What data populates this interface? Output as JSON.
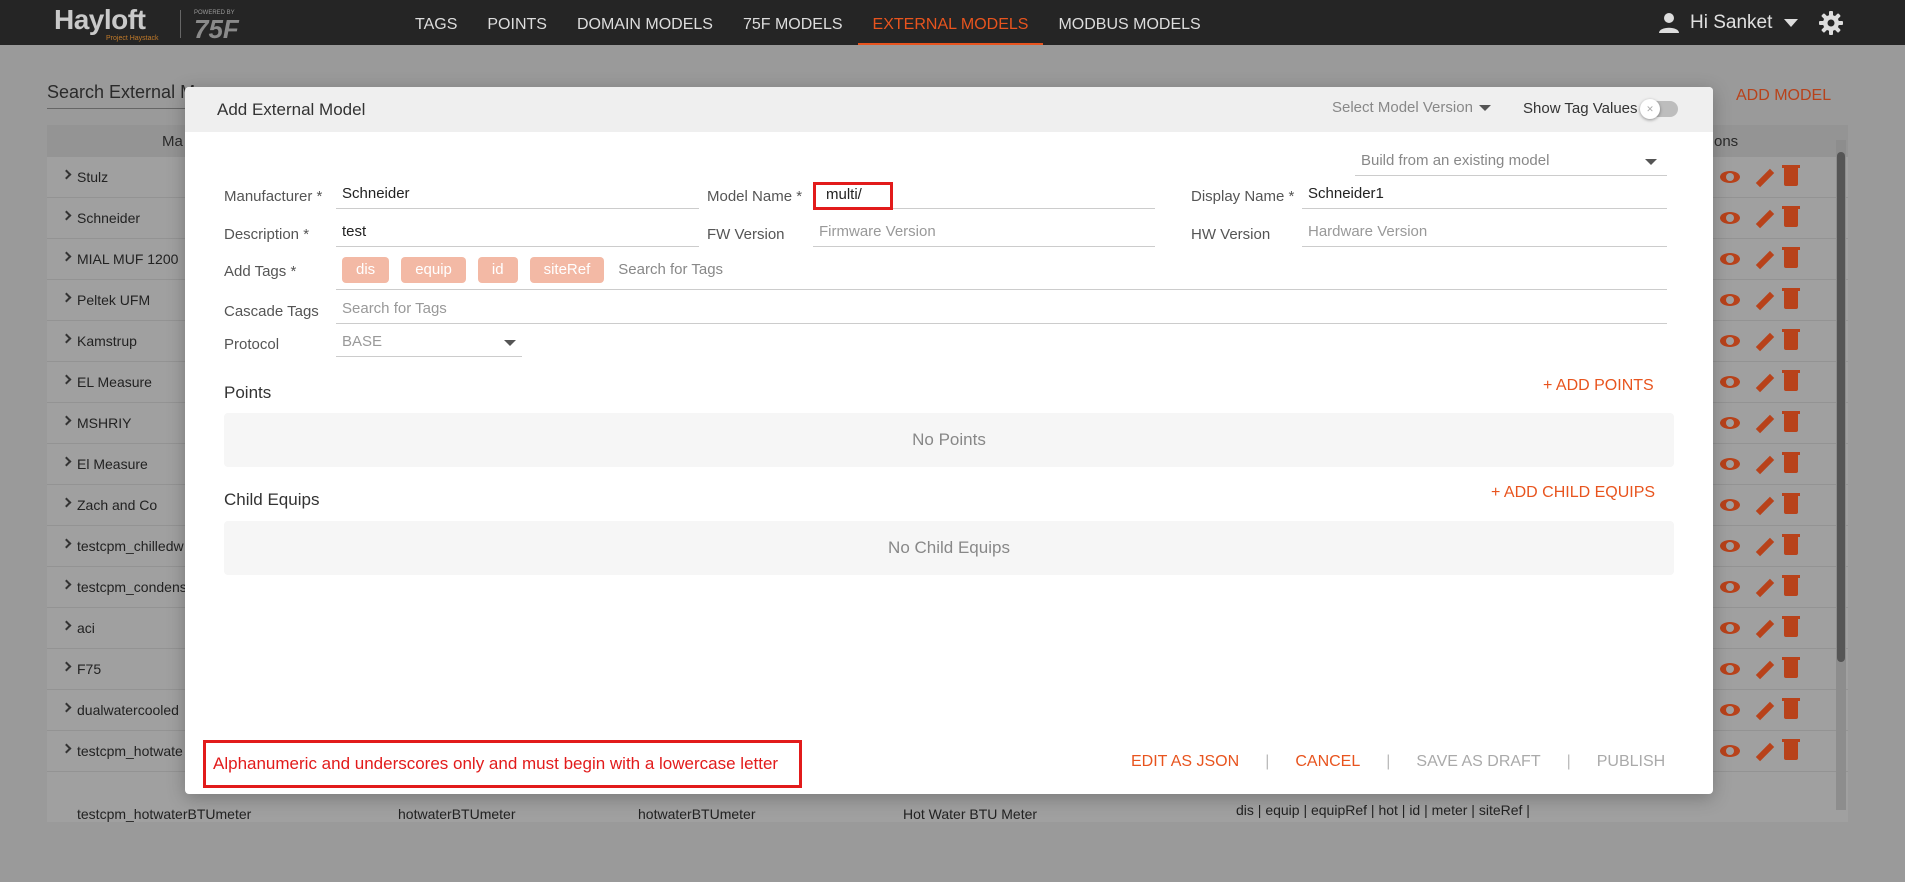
{
  "brand": {
    "name": "Hayloft",
    "tagline": "Project Haystack",
    "powered": "POWERED BY",
    "partner": "75F"
  },
  "nav": [
    {
      "label": "TAGS",
      "active": false
    },
    {
      "label": "POINTS",
      "active": false
    },
    {
      "label": "DOMAIN MODELS",
      "active": false
    },
    {
      "label": "75F MODELS",
      "active": false
    },
    {
      "label": "EXTERNAL MODELS",
      "active": true
    },
    {
      "label": "MODBUS MODELS",
      "active": false
    }
  ],
  "user": {
    "greeting": "Hi Sanket"
  },
  "background": {
    "search_label": "Search External M",
    "add_model": "ADD MODEL",
    "header_ma": "Ma",
    "header_actions": "ons",
    "rows": [
      {
        "name": "Stulz"
      },
      {
        "name": "Schneider"
      },
      {
        "name": "MIAL MUF 1200"
      },
      {
        "name": "Peltek UFM"
      },
      {
        "name": "Kamstrup"
      },
      {
        "name": "EL Measure"
      },
      {
        "name": "MSHRIY"
      },
      {
        "name": "El Measure"
      },
      {
        "name": "Zach and Co"
      },
      {
        "name": "testcpm_chilledw"
      },
      {
        "name": "testcpm_condens"
      },
      {
        "name": "aci"
      },
      {
        "name": "F75"
      },
      {
        "name": "dualwatercooled"
      },
      {
        "name": "testcpm_hotwate"
      }
    ],
    "last_row": {
      "name": "testcpm_hotwaterBTUmeter",
      "model": "hotwaterBTUmeter",
      "model2": "hotwaterBTUmeter",
      "display": "Hot Water BTU Meter",
      "tags": "dis | equip | equipRef | hot | id | meter | siteRef |"
    }
  },
  "modal": {
    "title": "Add External Model",
    "version_select": "Select Model Version",
    "show_tag_values": "Show Tag Values",
    "build_from": "Build from an existing model",
    "manufacturer": {
      "label": "Manufacturer *",
      "value": "Schneider"
    },
    "model_name": {
      "label": "Model Name *",
      "value": "multi/"
    },
    "display_name": {
      "label": "Display Name *",
      "value": "Schneider1"
    },
    "description": {
      "label": "Description *",
      "value": "test"
    },
    "fw_version": {
      "label": "FW Version",
      "placeholder": "Firmware Version"
    },
    "hw_version": {
      "label": "HW Version",
      "placeholder": "Hardware Version"
    },
    "add_tags": {
      "label": "Add Tags *",
      "chips": [
        "dis",
        "equip",
        "id",
        "siteRef"
      ],
      "placeholder": "Search for Tags"
    },
    "cascade_tags": {
      "label": "Cascade Tags",
      "placeholder": "Search for Tags"
    },
    "protocol": {
      "label": "Protocol",
      "value": "BASE"
    },
    "points": {
      "title": "Points",
      "add": "+ ADD POINTS",
      "empty": "No Points"
    },
    "child_equips": {
      "title": "Child Equips",
      "add": "+ ADD CHILD EQUIPS",
      "empty": "No Child Equips"
    },
    "error": "Alphanumeric and underscores only and must begin with a lowercase letter",
    "actions": {
      "edit_json": "EDIT AS JSON",
      "cancel": "CANCEL",
      "save_draft": "SAVE AS DRAFT",
      "publish": "PUBLISH"
    }
  },
  "colors": {
    "accent": "#e8541e",
    "error": "#e21b1b",
    "chip": "#f3b9a5",
    "topbar": "#252525"
  }
}
